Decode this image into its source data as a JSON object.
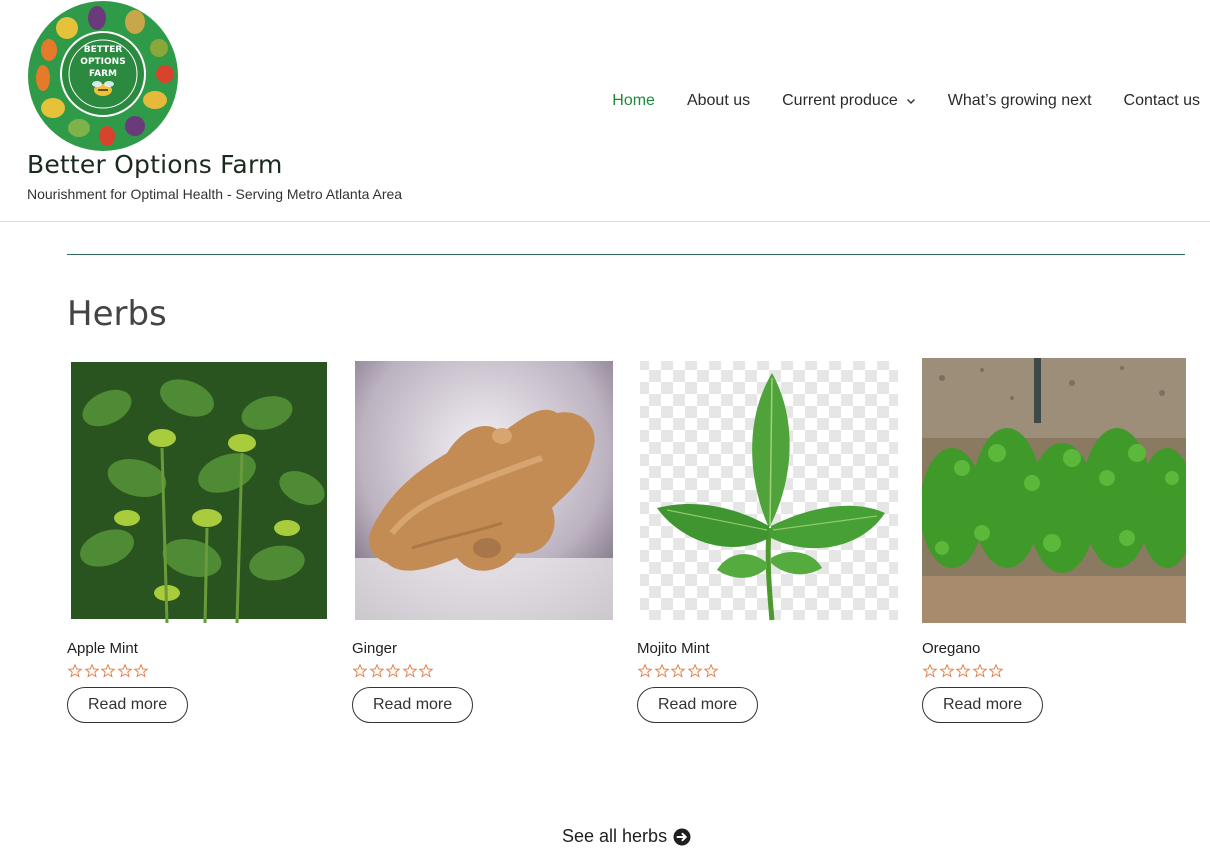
{
  "brand": {
    "title": "Better Options Farm",
    "tagline": "Nourishment for Optimal Health - Serving Metro Atlanta Area",
    "logo_text": "BETTER OPTIONS FARM",
    "logo_bg": "#2f9a48"
  },
  "nav": {
    "items": [
      {
        "label": "Home",
        "active": true
      },
      {
        "label": "About us"
      },
      {
        "label": "Current produce",
        "has_dropdown": true
      },
      {
        "label": "What’s growing next"
      },
      {
        "label": "Contact us"
      }
    ],
    "active_color": "#1e8a3a"
  },
  "section": {
    "heading": "Herbs",
    "see_all": "See all herbs"
  },
  "products": [
    {
      "name": "Apple Mint",
      "rating": 0,
      "button": "Read more",
      "image": "apple-mint-photo"
    },
    {
      "name": "Ginger",
      "rating": 0,
      "button": "Read more",
      "image": "ginger-root-photo"
    },
    {
      "name": "Mojito Mint",
      "rating": 0,
      "button": "Read more",
      "image": "mojito-mint-photo"
    },
    {
      "name": "Oregano",
      "rating": 0,
      "button": "Read more",
      "image": "oregano-plants-photo"
    }
  ],
  "colors": {
    "star": "#e8804b",
    "rule": "#2e6e58"
  }
}
